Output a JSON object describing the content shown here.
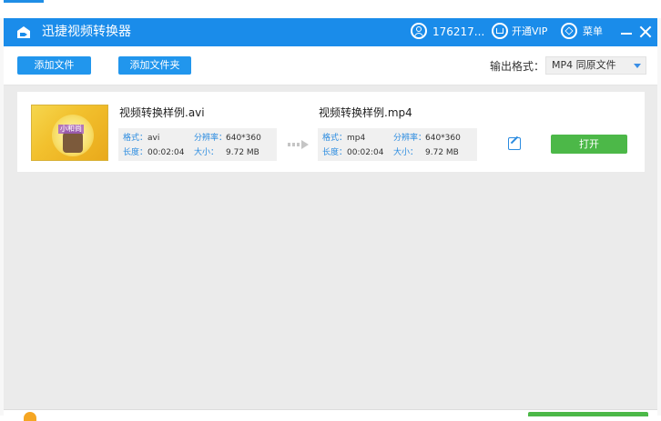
{
  "app": {
    "title": "迅捷视频转换器"
  },
  "header": {
    "user_id": "176217...",
    "vip_label": "开通VIP",
    "menu_label": "菜单"
  },
  "toolbar": {
    "add_file_label": "添加文件",
    "add_folder_label": "添加文件夹",
    "output_format_label": "输出格式：",
    "output_format_value": "MP4  同原文件"
  },
  "file": {
    "thumbnail_caption": "小和尚",
    "source": {
      "name": "视频转换样例.avi",
      "format_key": "格式：",
      "format_val": "avi",
      "resolution_key": "分辨率：",
      "resolution_val": "640*360",
      "duration_key": "长度：",
      "duration_val": "00:02:04",
      "size_key": "大小：",
      "size_val": "9.72 MB"
    },
    "target": {
      "name": "视频转换样例.mp4",
      "format_key": "格式：",
      "format_val": "mp4",
      "resolution_key": "分辨率：",
      "resolution_val": "640*360",
      "duration_key": "长度：",
      "duration_val": "00:02:04",
      "size_key": "大小：",
      "size_val": "9.72 MB"
    },
    "open_label": "打开"
  },
  "colors": {
    "titlebar": "#1a8cea",
    "button_blue": "#2196ed",
    "open_green": "#4cb848",
    "key_blue": "#2a8be0"
  },
  "icons": [
    "app-icon",
    "user-icon",
    "vip-icon",
    "menu-icon",
    "minimize-icon",
    "close-icon",
    "convert-arrow-icon",
    "edit-icon",
    "dropdown-arrow-icon"
  ]
}
